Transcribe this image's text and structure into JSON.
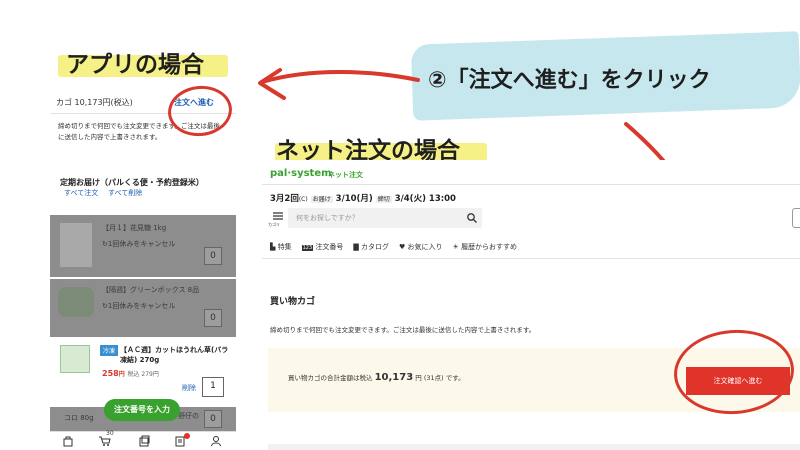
{
  "annotations": {
    "app_heading": "アプリの場合",
    "net_heading": "ネット注文の場合",
    "instruction": "②「注文へ進む」をクリック"
  },
  "colors": {
    "accent_red": "#d9382c",
    "brand_green": "#39a12d",
    "highlight": "#f4f07a",
    "brush_blue": "#c7e7ef"
  },
  "app": {
    "cart_total": "カゴ 10,173円(税込)",
    "proceed_link": "注文へ進む",
    "notice": "締め切りまで何回でも注文変更できます。ご注文は最後に送信した内容で上書きされます。",
    "section_title": "定期お届け（パルくる便・予約登録米）",
    "link_all_order": "すべて注文",
    "link_all_cancel": "すべて削除",
    "items": [
      {
        "name": "【月１】花見糖 1kg",
        "action": "1回休みをキャンセル",
        "qty": "0"
      },
      {
        "name": "【隔週】グリーンボックス 8品",
        "action": "1回休みをキャンセル",
        "qty": "0"
      },
      {
        "badge": "冷凍",
        "name": "【ＡＣ週】カットほうれん草(バラ凍結) 270g",
        "price": "258",
        "price_unit": "円",
        "price_tax": "税込 279円",
        "delete": "削除",
        "qty": "1"
      },
      {
        "name": "コロ 80g",
        "extra": "野仔の",
        "qty": "0"
      }
    ],
    "fab_label": "注文番号を入力",
    "bottom_nav": [
      {
        "icon": "bag-icon"
      },
      {
        "icon": "cart-icon",
        "badge": "30"
      },
      {
        "icon": "catalog-icon"
      },
      {
        "icon": "book-icon",
        "dot": true
      },
      {
        "icon": "user-icon"
      }
    ]
  },
  "net": {
    "logo": "pal·system",
    "logo_sub": "ネット注文",
    "round": "3月2回",
    "round_day": "(C)",
    "delivery_label": "お届け",
    "delivery_date": "3/10(月)",
    "deadline_label": "締切",
    "deadline_date": "3/4(火) 13:00",
    "cart_icon_label": "カゴリ",
    "search_placeholder": "何をお探しですか？",
    "nav": [
      "特集",
      "注文番号",
      "カタログ",
      "お気に入り",
      "履歴からおすすめ"
    ],
    "cart_title": "買い物カゴ",
    "notice": "締め切りまで何回でも注文変更できます。ご注文は最後に送信した内容で上書きされます。",
    "total_prefix": "買い物カゴの合計金額は税込",
    "total_value": "10,173",
    "total_unit": "円",
    "total_count": "(31点)",
    "total_suffix": "です。",
    "confirm_button": "注文確認へ進む"
  }
}
